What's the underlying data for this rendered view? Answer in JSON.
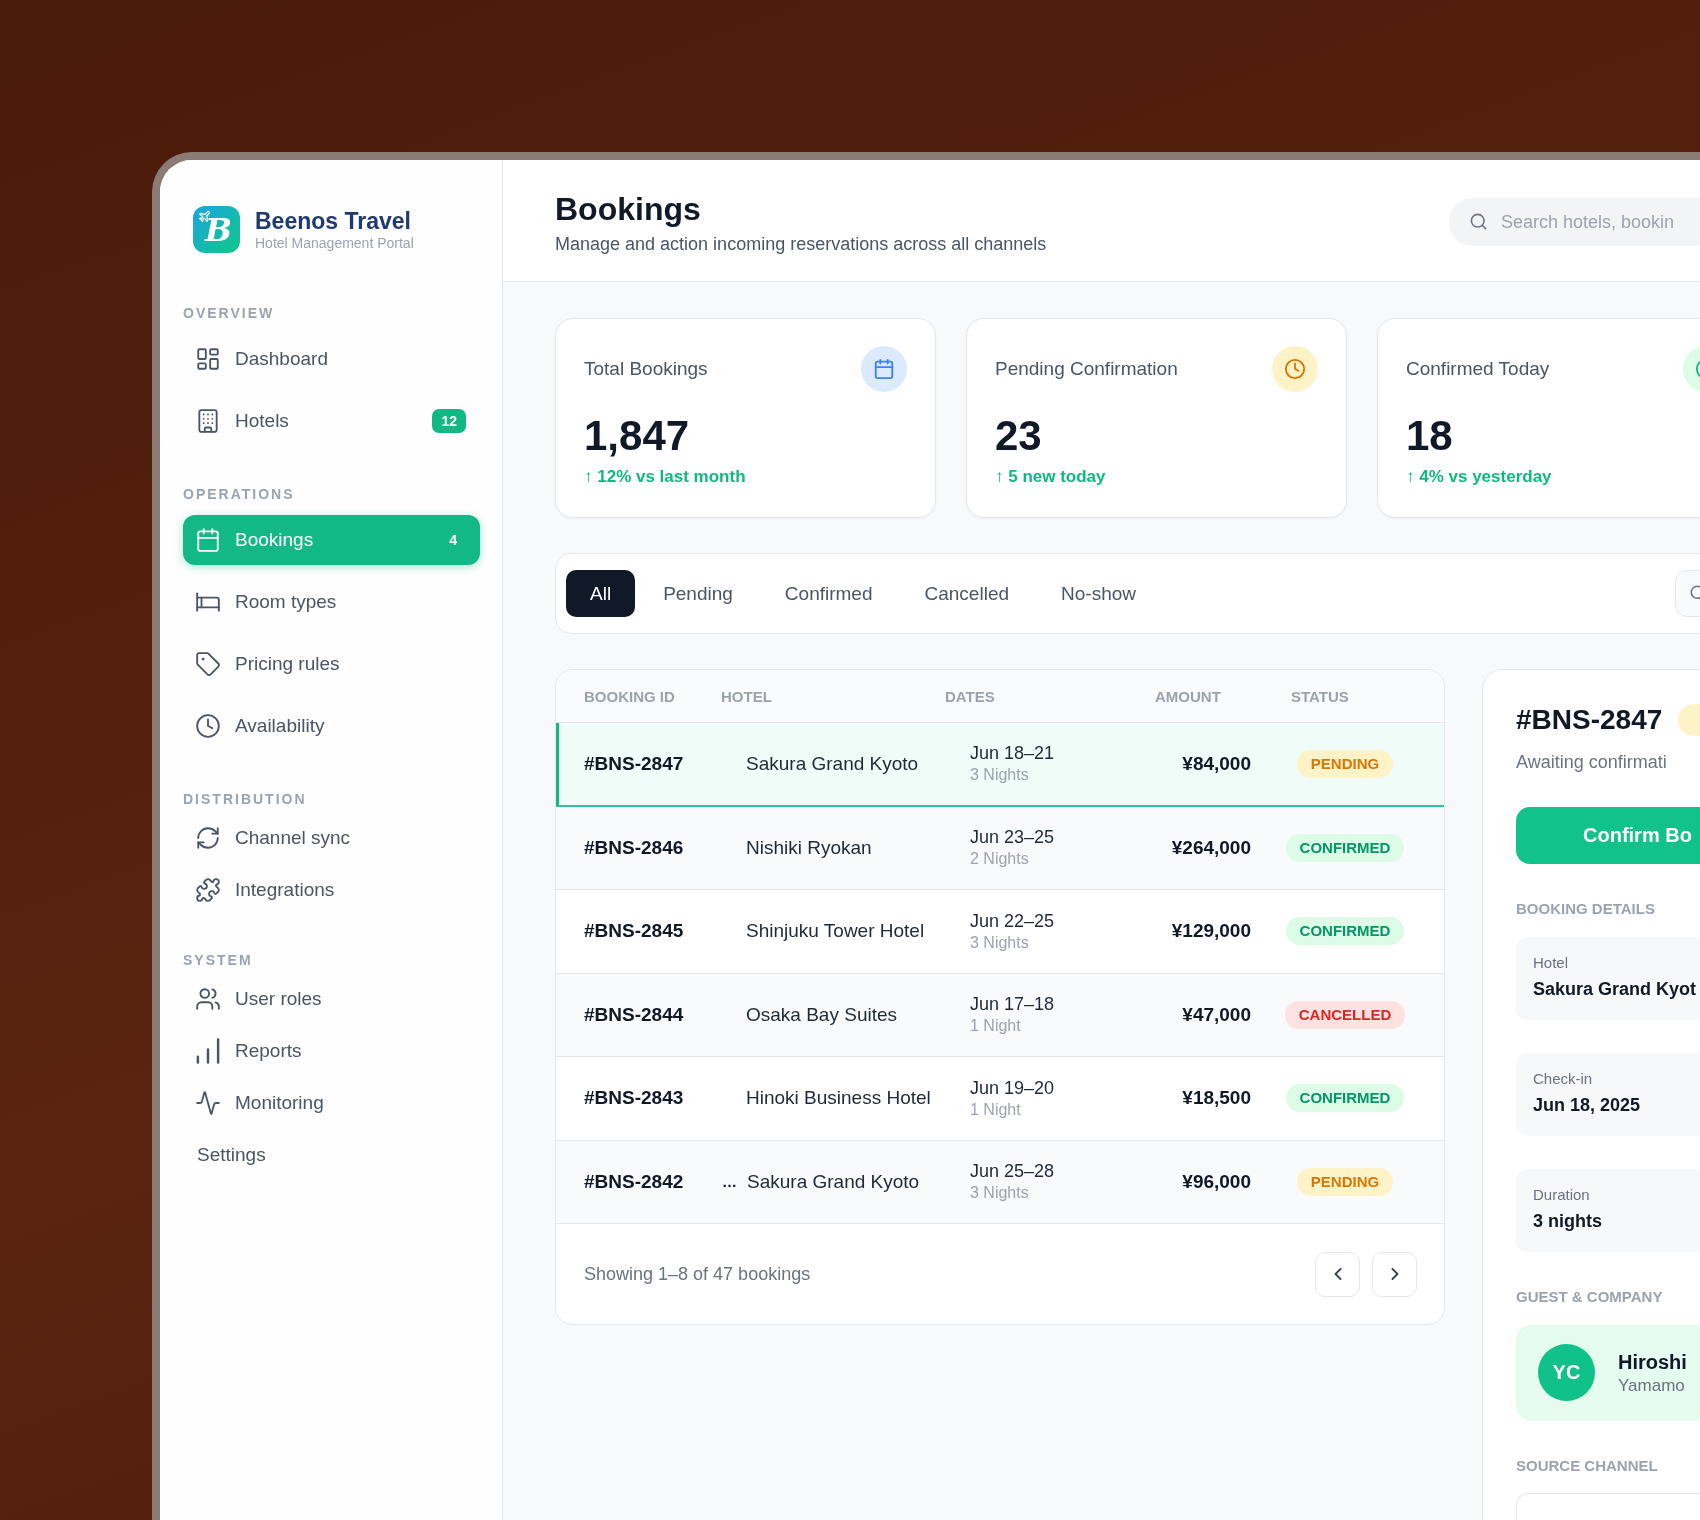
{
  "brand": {
    "mark": "B",
    "name": "Beenos Travel",
    "tagline": "Hotel Management Portal"
  },
  "sidebar": {
    "sections": [
      {
        "title": "OVERVIEW",
        "items": [
          {
            "label": "Dashboard",
            "selected": false
          },
          {
            "label": "Hotels",
            "badge": "12",
            "selected": false
          }
        ]
      },
      {
        "title": "OPERATIONS",
        "items": [
          {
            "label": "Bookings",
            "badge": "4",
            "selected": true
          },
          {
            "label": "Room types",
            "selected": false
          },
          {
            "label": "Pricing rules",
            "selected": false
          },
          {
            "label": "Availability",
            "selected": false
          }
        ]
      },
      {
        "title": "DISTRIBUTION",
        "items": [
          {
            "label": "Channel sync",
            "selected": false
          },
          {
            "label": "Integrations",
            "selected": false
          }
        ]
      },
      {
        "title": "SYSTEM",
        "items": [
          {
            "label": "User roles",
            "selected": false
          },
          {
            "label": "Reports",
            "selected": false
          },
          {
            "label": "Monitoring",
            "selected": false
          },
          {
            "label": "Settings",
            "selected": false
          }
        ]
      }
    ]
  },
  "header": {
    "title": "Bookings",
    "subtitle": "Manage and action incoming reservations across all channels",
    "search": {
      "placeholder": "Search hotels, bookin"
    }
  },
  "stats": [
    {
      "label": "Total Bookings",
      "value": "1,847",
      "delta": "↑ 12% vs last month"
    },
    {
      "label": "Pending Confirmation",
      "value": "23",
      "delta": "↑ 5 new today"
    },
    {
      "label": "Confirmed Today",
      "value": "18",
      "delta": "↑ 4% vs yesterday"
    }
  ],
  "filter_tabs": [
    {
      "label": "All",
      "selected": true
    },
    {
      "label": "Pending",
      "selected": false
    },
    {
      "label": "Confirmed",
      "selected": false
    },
    {
      "label": "Cancelled",
      "selected": false
    },
    {
      "label": "No-show",
      "selected": false
    }
  ],
  "table": {
    "columns": [
      "BOOKING ID",
      "HOTEL",
      "DATES",
      "AMOUNT",
      "STATUS"
    ],
    "rows": [
      {
        "id": "#BNS-2847",
        "hotel": "Sakura Grand Kyoto",
        "dates": "Jun 18–21",
        "nights": "3 Nights",
        "amount": "¥84,000",
        "status": {
          "label": "PENDING",
          "kind": "pending"
        },
        "selected": true
      },
      {
        "id": "#BNS-2846",
        "hotel": "Nishiki Ryokan",
        "dates": "Jun 23–25",
        "nights": "2 Nights",
        "amount": "¥264,000",
        "status": {
          "label": "CONFIRMED",
          "kind": "confirmed"
        },
        "selected": false
      },
      {
        "id": "#BNS-2845",
        "hotel": "Shinjuku Tower Hotel",
        "dates": "Jun 22–25",
        "nights": "3 Nights",
        "amount": "¥129,000",
        "status": {
          "label": "CONFIRMED",
          "kind": "confirmed"
        },
        "selected": false
      },
      {
        "id": "#BNS-2844",
        "hotel": "Osaka Bay Suites",
        "dates": "Jun 17–18",
        "nights": "1 Night",
        "amount": "¥47,000",
        "status": {
          "label": "CANCELLED",
          "kind": "cancelled"
        },
        "selected": false
      },
      {
        "id": "#BNS-2843",
        "hotel": "Hinoki Business Hotel",
        "dates": "Jun 19–20",
        "nights": "1 Night",
        "amount": "¥18,500",
        "status": {
          "label": "CONFIRMED",
          "kind": "confirmed"
        },
        "selected": false
      },
      {
        "id": "#BNS-2842",
        "prefix": "…",
        "hotel": "Sakura Grand Kyoto",
        "dates": "Jun 25–28",
        "nights": "3 Nights",
        "amount": "¥96,000",
        "status": {
          "label": "PENDING",
          "kind": "pending"
        },
        "selected": false
      }
    ],
    "footer": "Showing 1–8 of 47 bookings"
  },
  "detail": {
    "title": "#BNS-2847",
    "subtitle": "Awaiting confirmati",
    "primary_action": "Confirm Bo",
    "details_title": "BOOKING DETAILS",
    "fields": [
      {
        "label": "Hotel",
        "value": "Sakura Grand Kyot"
      },
      {
        "label": "Check-in",
        "value": "Jun 18, 2025"
      },
      {
        "label": "Duration",
        "value": "3 nights"
      }
    ],
    "guest_title": "GUEST & COMPANY",
    "guest": {
      "initials": "YC",
      "name": "Hiroshi",
      "company": "Yamamo"
    },
    "channel_title": "SOURCE CHANNEL"
  }
}
